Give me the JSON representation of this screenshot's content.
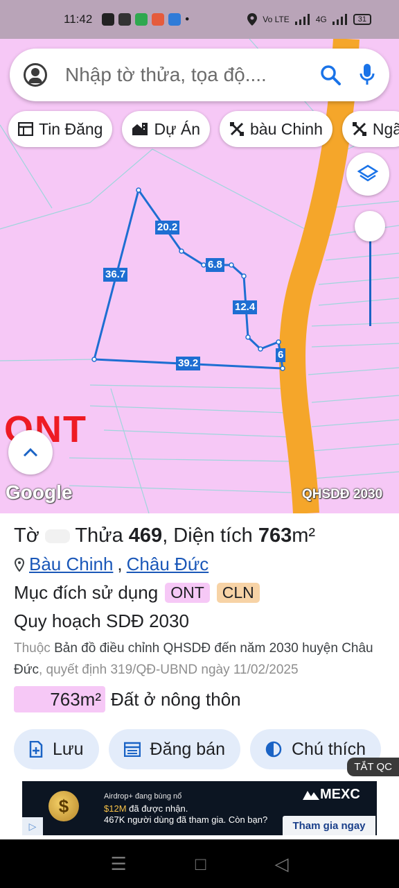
{
  "status_bar": {
    "time": "11:42",
    "carrier": "Vo LTE",
    "network": "4G",
    "battery": "31",
    "notification_dot": "•"
  },
  "search": {
    "placeholder": "Nhập tờ thửa, tọa độ...."
  },
  "chips": [
    {
      "label": "Tin Đăng",
      "icon": "listing-icon"
    },
    {
      "label": "Dự Án",
      "icon": "building-icon"
    },
    {
      "label": "bàu Chinh",
      "icon": "tools-icon"
    },
    {
      "label": "Ngã",
      "icon": "tools-icon"
    }
  ],
  "map": {
    "edge_labels": [
      "20.2",
      "36.7",
      "6.8",
      "12.4",
      "6",
      "39.2"
    ],
    "zone_label": "ONT",
    "attribution": "Google",
    "layer_name": "QHSDĐ 2030",
    "colors": {
      "zone_pink": "#f6c8f6",
      "road_orange": "#f5a62a",
      "boundary_blue": "#1e6ed2",
      "ont_red": "#ee1b24"
    }
  },
  "parcel": {
    "sheet_label": "Tờ",
    "sheet_number": "",
    "plot_label": "Thửa",
    "plot_number": "469",
    "area_label": ", Diện tích",
    "area_value": "763",
    "area_unit": "m²",
    "commune": "Bàu Chinh",
    "district": "Châu Đức",
    "separator": ",",
    "purpose_label": "Mục đích sử dụng",
    "purpose_tags": [
      "ONT",
      "CLN"
    ],
    "plan_title": "Quy hoạch SDĐ 2030",
    "plan_prefix": "Thuộc",
    "plan_desc": "Bản đồ điều chỉnh QHSDĐ đến năm 2030 huyện Châu Đức",
    "plan_decision": ", quyết định 319/QĐ-UBND ngày 11/02/2025",
    "zone_area": "763m²",
    "zone_desc": "Đất ở nông thôn"
  },
  "actions": [
    {
      "label": "Lưu",
      "icon": "add-note-icon"
    },
    {
      "label": "Đăng bán",
      "icon": "calendar-list-icon"
    },
    {
      "label": "Chú thích",
      "icon": "contrast-icon"
    }
  ],
  "ad": {
    "hide_label": "TẮT QC",
    "line1": "Airdrop+ đang bùng nổ",
    "line2_highlight": "$12M",
    "line2_rest": " đã được nhận.",
    "line3": "467K người dùng đã tham gia. Còn bạn?",
    "brand": "MEXC",
    "cta": "Tham gia ngay",
    "coin_symbol": "$"
  },
  "nav": {
    "menu": "☰",
    "home": "□",
    "back": "◁"
  }
}
